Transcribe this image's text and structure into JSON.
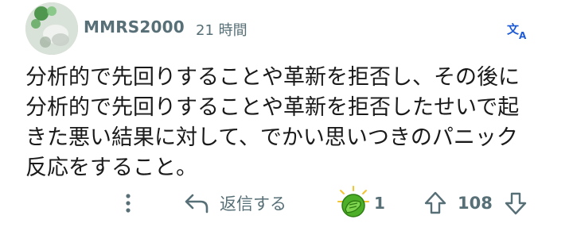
{
  "comment": {
    "author": "MMRS2000",
    "time": "21 時間",
    "body_lines": [
      "分析的で先回りすることや革新を拒否し、その後に",
      "分析的で先回りすることや革新を拒否したせいで起",
      "きた悪い結果に対して、でかい思いつきのパニック",
      "反応をすること。"
    ]
  },
  "header": {
    "translate_icon": "translate-icon"
  },
  "actions": {
    "more_icon": "more-vertical-icon",
    "reply_icon": "reply-arrow-icon",
    "reply_label": "返信する",
    "award_icon": "facepalm-award-icon",
    "award_count": "1",
    "upvote_icon": "upvote-arrow-icon",
    "score": "108",
    "downvote_icon": "downvote-arrow-icon"
  },
  "colors": {
    "meta_text": "#576f76",
    "body_text": "#1a1a1b",
    "translate_accent": "#1d5bd6",
    "award_green": "#4caf27"
  }
}
